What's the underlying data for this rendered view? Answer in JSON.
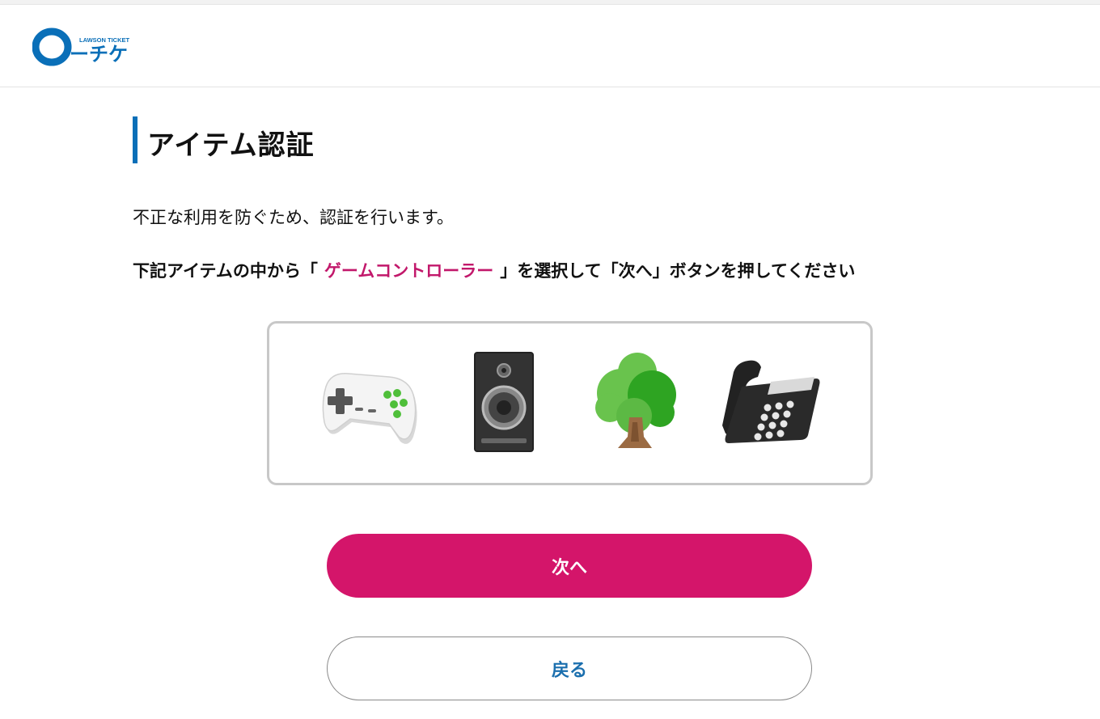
{
  "header": {
    "logo_small_text": "LAWSON TICKET",
    "logo_text": "ーチケ"
  },
  "page": {
    "title": "アイテム認証",
    "intro": "不正な利用を防ぐため、認証を行います。",
    "instruction_before": "下記アイテムの中から「",
    "instruction_target": "ゲームコントローラー",
    "instruction_after": "」を選択して「次へ」ボタンを押してください"
  },
  "items": [
    {
      "icon": "game-controller-icon"
    },
    {
      "icon": "speaker-icon"
    },
    {
      "icon": "tree-icon"
    },
    {
      "icon": "telephone-icon"
    }
  ],
  "buttons": {
    "next_label": "次へ",
    "back_label": "戻る"
  },
  "colors": {
    "brand_blue": "#0a6fb8",
    "accent_pink": "#d4156a",
    "target_text": "#c2186b"
  }
}
